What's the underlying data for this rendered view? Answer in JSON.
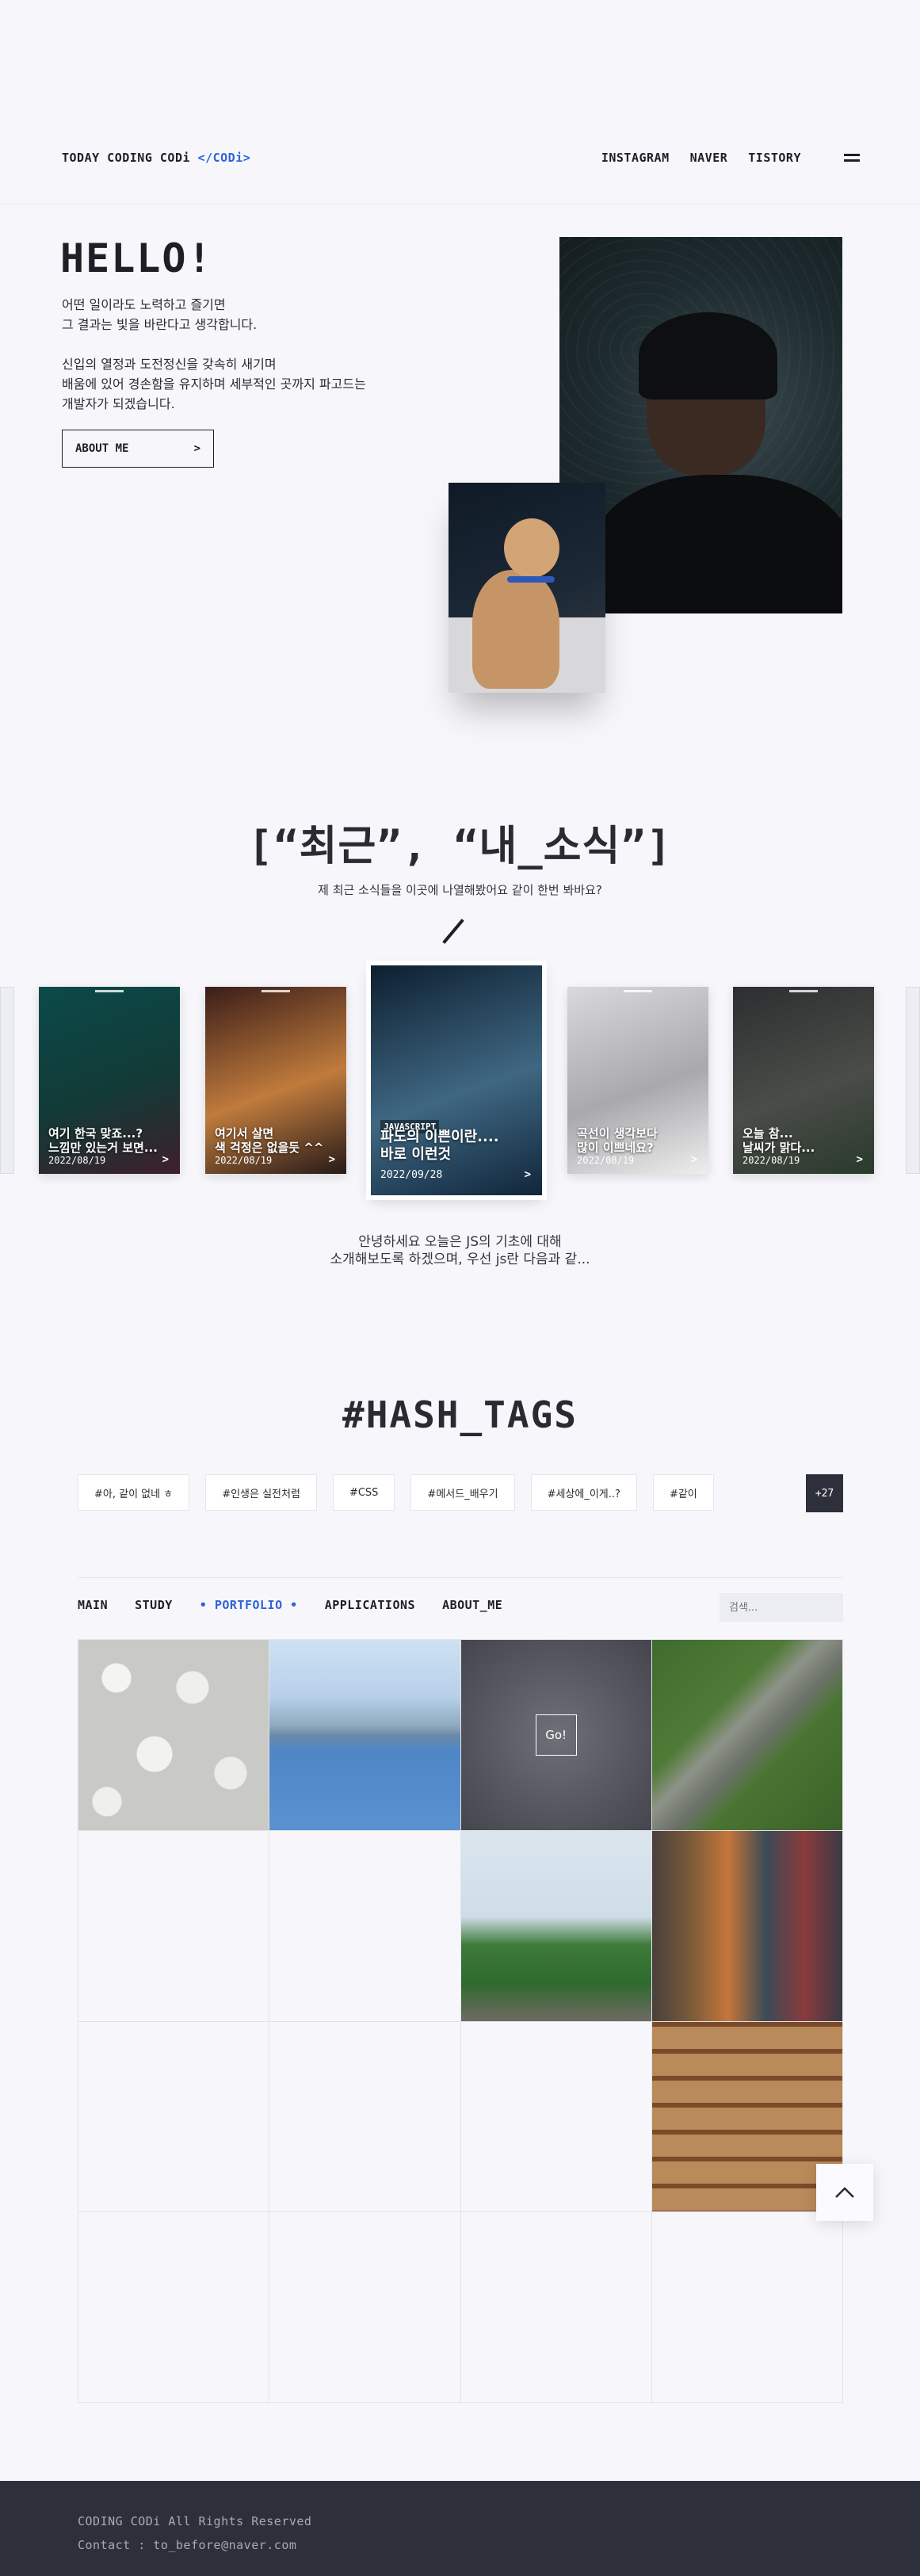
{
  "header": {
    "logo_text": "TODAY CODING CODi",
    "logo_code": "</CODi>",
    "nav": [
      "INSTAGRAM",
      "NAVER",
      "TISTORY"
    ]
  },
  "hero": {
    "title": "HELLO!",
    "para1": "어떤 일이라도 노력하고 즐기면\n그 결과는 빛을 바란다고 생각합니다.",
    "para2": "신입의 열정과 도전정신을 갖속히 새기며\n배움에 있어 경손함을 유지하며 세부적인 곳까지 파고드는\n개발자가 되겠습니다.",
    "about_label": "ABOUT ME",
    "about_arrow": ">"
  },
  "news": {
    "title": "[“최근”, “내_소식”]",
    "subtitle": "제 최근 소식들을 이곳에 나열해봤어요 같이 한번 봐바요?",
    "cards": [
      {
        "title": "여기 한국 맞죠...?\n느낌만 있는거 보면...",
        "date": "2022/08/19",
        "colors": [
          "#0b4a4a",
          "#123a36",
          "#3e1f2c"
        ]
      },
      {
        "title": "여기서 살면\n색 걱정은 없을듯 ^^",
        "date": "2022/08/19",
        "colors": [
          "#3a1d1a",
          "#c07b3c",
          "#261a19"
        ]
      },
      {
        "tag": "JAVASCRIPT",
        "title": "파도의 이쁜이란....\n바로 이런것",
        "date": "2022/09/28",
        "colors": [
          "#0d1f30",
          "#3f6782",
          "#10263b"
        ]
      },
      {
        "title": "곡선이 생각보다\n많이 이쁘네요?",
        "date": "2022/08/19",
        "colors": [
          "#d9d9db",
          "#a9a9ad",
          "#eeeeee"
        ]
      },
      {
        "title": "오늘 참...\n날씨가 맑다...",
        "date": "2022/08/19",
        "colors": [
          "#2c2f30",
          "#4a4c48",
          "#2a3a2c"
        ]
      }
    ],
    "arrow": ">",
    "description": "안녕하세요 오늘은 JS의 기초에 대해\n소개해보도록 하겠으며, 우선 js란 다음과 같..."
  },
  "hashtags": {
    "title": "#HASH_TAGS",
    "tags": [
      "#아, 같이 없네 ㅎ",
      "#인생은 실전처럼",
      "#CSS",
      "#메서드_배우기",
      "#세상에_이게..?",
      "#같이"
    ],
    "more": "+27"
  },
  "portfolio": {
    "tabs": [
      "MAIN",
      "STUDY",
      "• PORTFOLIO •",
      "APPLICATIONS",
      "ABOUT_ME"
    ],
    "active_tab": 2,
    "search_placeholder": "검색...",
    "go_label": "Go!"
  },
  "footer": {
    "line1": "CODING CODi All Rights Reserved",
    "line2": "Contact : to_before@naver.com"
  }
}
